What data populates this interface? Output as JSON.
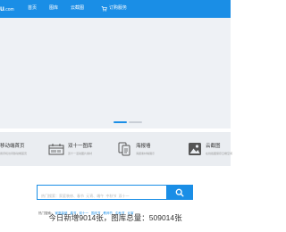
{
  "header": {
    "logo_text": "u",
    "logo_suffix": ".com",
    "nav": [
      {
        "label": "首页"
      },
      {
        "label": "图库"
      },
      {
        "label": "云截图"
      },
      {
        "label": "订购服务"
      }
    ]
  },
  "carousel": {
    "slides": 2,
    "active": 1
  },
  "features": [
    {
      "title": "移动端首页",
      "subtitle": "用手机访问移动端首页",
      "icon": "mobile-icon"
    },
    {
      "title": "双十一图库",
      "subtitle": "双十一活动图片素材",
      "icon": "calendar-icon"
    },
    {
      "title": "海报墙",
      "subtitle": "海报素材墙展示",
      "icon": "poster-icon"
    },
    {
      "title": "云截图",
      "subtitle": "在线截图保存云端空间",
      "icon": "image-icon"
    }
  ],
  "search": {
    "placeholder": "热门搜索：家庭装修、春节  元宵、端午  中秋节  双十一"
  },
  "hot_search": {
    "label": "热门搜索：",
    "tags": [
      "家庭装修",
      "春节",
      "双十一",
      "国庆节",
      "教师节",
      "中秋节",
      "元宵"
    ]
  },
  "stats": {
    "text": "今日新增9014张，图库总量：509014张"
  },
  "colors": {
    "brand": "#1a8ee6",
    "band": "#eaedf1",
    "hero": "#eef1f5"
  }
}
